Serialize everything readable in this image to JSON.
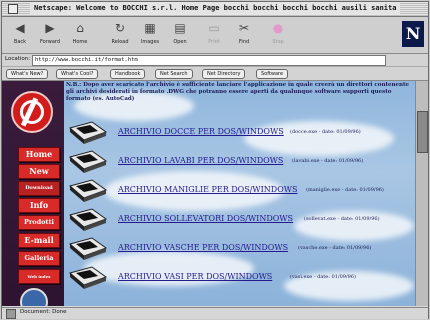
{
  "window": {
    "title": "Netscape: Welcome to BOCCHI s.r.l. Home Page bocchi bocchi bocchi bocchi ausili sanita"
  },
  "toolbar": {
    "buttons": [
      {
        "label": "Back",
        "icon": "back-arrow-icon"
      },
      {
        "label": "Forward",
        "icon": "forward-arrow-icon"
      },
      {
        "label": "Home",
        "icon": "home-icon"
      },
      {
        "label": "Reload",
        "icon": "reload-icon"
      },
      {
        "label": "Images",
        "icon": "images-icon"
      },
      {
        "label": "Open",
        "icon": "open-icon"
      },
      {
        "label": "Print",
        "icon": "print-icon"
      },
      {
        "label": "Find",
        "icon": "find-icon"
      },
      {
        "label": "Stop",
        "icon": "stop-icon"
      }
    ],
    "logo": "N"
  },
  "location": {
    "label": "Location:",
    "value": "http://www.bocchi.it/format.htm"
  },
  "directory_buttons": [
    "What's New?",
    "What's Cool?",
    "Handbook",
    "Net Search",
    "Net Directory",
    "Software"
  ],
  "sidebar": {
    "nav": [
      "Home",
      "New",
      "Download",
      "Info",
      "Prodotti",
      "E-mail",
      "Galleria",
      "Web index"
    ]
  },
  "intro_text": "N.B.: Dopo aver scaricato l'archivio è sufficiente lanciare l'applicazione in quale creerà un direttori contenente gli archivi desiderati in formato .DWG che potranno essere aperti da qualunque software supporti questo formato (es. AutoCad)",
  "archives": [
    {
      "name": "ARCHIVIO DOCCE PER DOS/WINDOWS",
      "meta": "(docce.exe - date: 01/09/96)"
    },
    {
      "name": "ARCHIVIO LAVABI PER DOS/WINDOWS",
      "meta": "(lavabi.exe - date: 01/09/96)"
    },
    {
      "name": "ARCHIVIO MANIGLIE PER DOS/WINDOWS",
      "meta": "(maniglie.exe - date: 01/09/96)"
    },
    {
      "name": "ARCHIVIO SOLLEVATORI DOS/WINDOWS",
      "meta": "(sollevat.exe - date: 01/09/96)"
    },
    {
      "name": "ARCHIVIO VASCHE PER DOS/WINDOWS",
      "meta": "(vasche.exe - date: 01/09/96)"
    },
    {
      "name": "ARCHIVIO VASI PER DOS/WINDOWS",
      "meta": "(vasi.exe - date: 01/09/96)"
    }
  ],
  "status": {
    "text": "Document: Done"
  }
}
